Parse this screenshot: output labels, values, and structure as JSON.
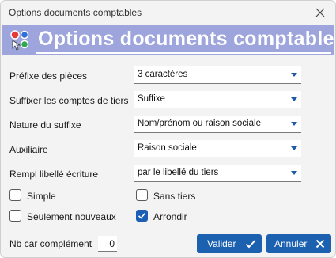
{
  "window": {
    "title": "Options documents comptables"
  },
  "banner": {
    "title": "Options documents comptables",
    "icon": "options-dots-icon"
  },
  "fields": [
    {
      "label": "Préfixe des pièces",
      "value": "3 caractères"
    },
    {
      "label": "Suffixer les comptes de tiers",
      "value": "Suffixe"
    },
    {
      "label": "Nature du suffixe",
      "value": "Nom/prénom ou raison sociale"
    },
    {
      "label": "Auxiliaire",
      "value": "Raison sociale"
    },
    {
      "label": "Rempl libellé écriture",
      "value": "par le libellé du tiers"
    }
  ],
  "checkboxes": {
    "simple": {
      "label": "Simple",
      "checked": false
    },
    "sans_tiers": {
      "label": "Sans tiers",
      "checked": false
    },
    "seulement_nouveaux": {
      "label": "Seulement nouveaux",
      "checked": false
    },
    "arrondir": {
      "label": "Arrondir",
      "checked": true
    }
  },
  "nb_car": {
    "label": "Nb car complément",
    "value": "0"
  },
  "buttons": {
    "valider": "Valider",
    "annuler": "Annuler"
  },
  "colors": {
    "banner": "#9ea5dc",
    "accent": "#1c60b0"
  }
}
